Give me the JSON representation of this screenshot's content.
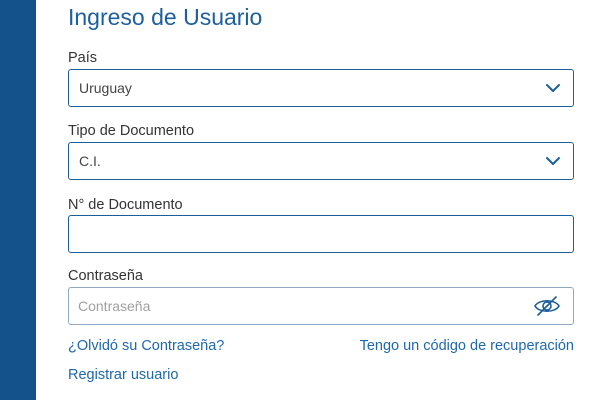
{
  "form": {
    "title": "Ingreso de Usuario",
    "country": {
      "label": "País",
      "value": "Uruguay"
    },
    "doc_type": {
      "label": "Tipo de Documento",
      "value": "C.I."
    },
    "doc_number": {
      "label": "N° de Documento",
      "value": ""
    },
    "password": {
      "label": "Contraseña",
      "placeholder": "Contraseña"
    },
    "links": {
      "forgot_password": "¿Olvidó su Contraseña?",
      "recovery_code": "Tengo un código de recuperación",
      "register": "Registrar usuario"
    }
  },
  "icons": {
    "country_dropdown": "chevron-down-icon",
    "doc_type_dropdown": "chevron-down-icon",
    "password_toggle": "eye-slash-icon"
  },
  "colors": {
    "sidebar": "#14528b",
    "title": "#1c5f9e",
    "field_border": "#1d5e98",
    "link": "#1f68ad",
    "icon": "#1d5e98"
  }
}
